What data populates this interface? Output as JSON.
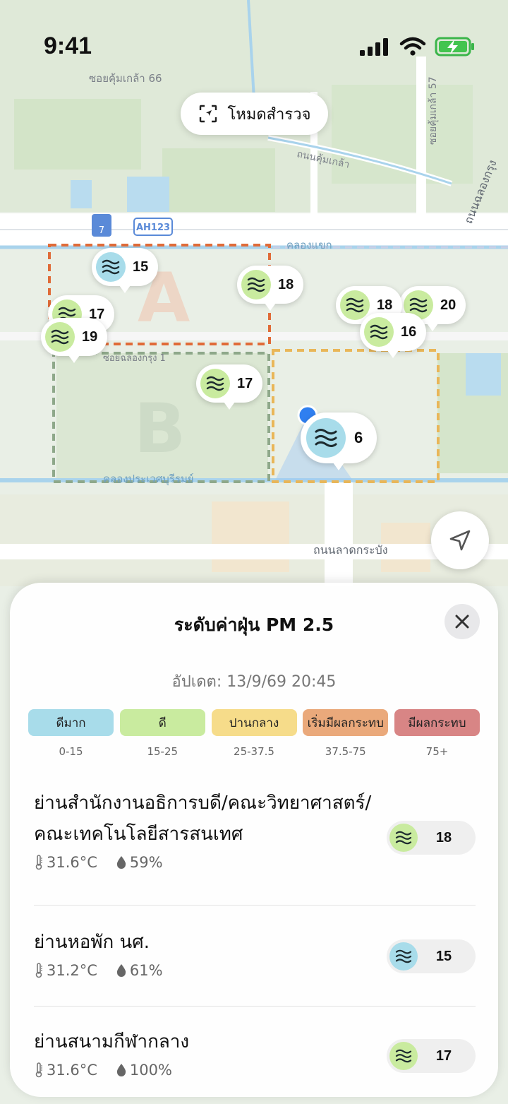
{
  "status_bar": {
    "time": "9:41"
  },
  "map": {
    "labels": {
      "soi_khum_klao_66": "ซอยคุ้มเกล้า 66",
      "soi_khum_klao_57": "ซอยคุ้มเกล้า 57",
      "thanon_khum_klao": "ถนนคุ้มเกล้า",
      "thanon_chalong_krung": "ถนนฉลองกรุง",
      "khlong_saeng": "คลองแขก",
      "soi_chalong_krung_1": "ซอยฉลองกรุง 1",
      "khlong_prawet": "คลองประเวศบุรีรมย์",
      "thanon_lat_krabang": "ถนนลาดกระบัง",
      "ah_shield": "AH123",
      "route_shield": "7",
      "zone_a": "A",
      "zone_b": "B"
    },
    "survey_button": "โหมดสำรวจ",
    "pins": [
      {
        "value": "15",
        "level": "very-good"
      },
      {
        "value": "17",
        "level": "good"
      },
      {
        "value": "19",
        "level": "good"
      },
      {
        "value": "18",
        "level": "good"
      },
      {
        "value": "17",
        "level": "good"
      },
      {
        "value": "18",
        "level": "good"
      },
      {
        "value": "20",
        "level": "good"
      },
      {
        "value": "16",
        "level": "good"
      },
      {
        "value": "6",
        "level": "very-good"
      }
    ]
  },
  "sheet": {
    "title": "ระดับค่าฝุ่น PM 2.5",
    "updated": "อัปเดต: 13/9/69 20:45",
    "legend": [
      {
        "label": "ดีมาก",
        "range": "0-15",
        "color": "#a8dcea"
      },
      {
        "label": "ดี",
        "range": "15-25",
        "color": "#c9eb9f"
      },
      {
        "label": "ปานกลาง",
        "range": "25-37.5",
        "color": "#f6dc8a"
      },
      {
        "label": "เริ่มมีผลกระทบ",
        "range": "37.5-75",
        "color": "#eaa97b"
      },
      {
        "label": "มีผลกระทบ",
        "range": "75+",
        "color": "#d88585"
      }
    ],
    "locations": [
      {
        "name": "ย่านสำนักงานอธิการบดี/คณะวิทยาศาสตร์/คณะเทคโนโลยีสารสนเทศ",
        "temp": "31.6°C",
        "humidity": "59%",
        "aqi": "18",
        "level": "good"
      },
      {
        "name": "ย่านหอพัก นศ.",
        "temp": "31.2°C",
        "humidity": "61%",
        "aqi": "15",
        "level": "very-good"
      },
      {
        "name": "ย่านสนามกีฬากลาง",
        "temp": "31.6°C",
        "humidity": "100%",
        "aqi": "17",
        "level": "good"
      }
    ]
  },
  "colors": {
    "very_good": "#a8dcea",
    "good": "#c9eb9f",
    "accent_blue": "#2f7ff0"
  }
}
